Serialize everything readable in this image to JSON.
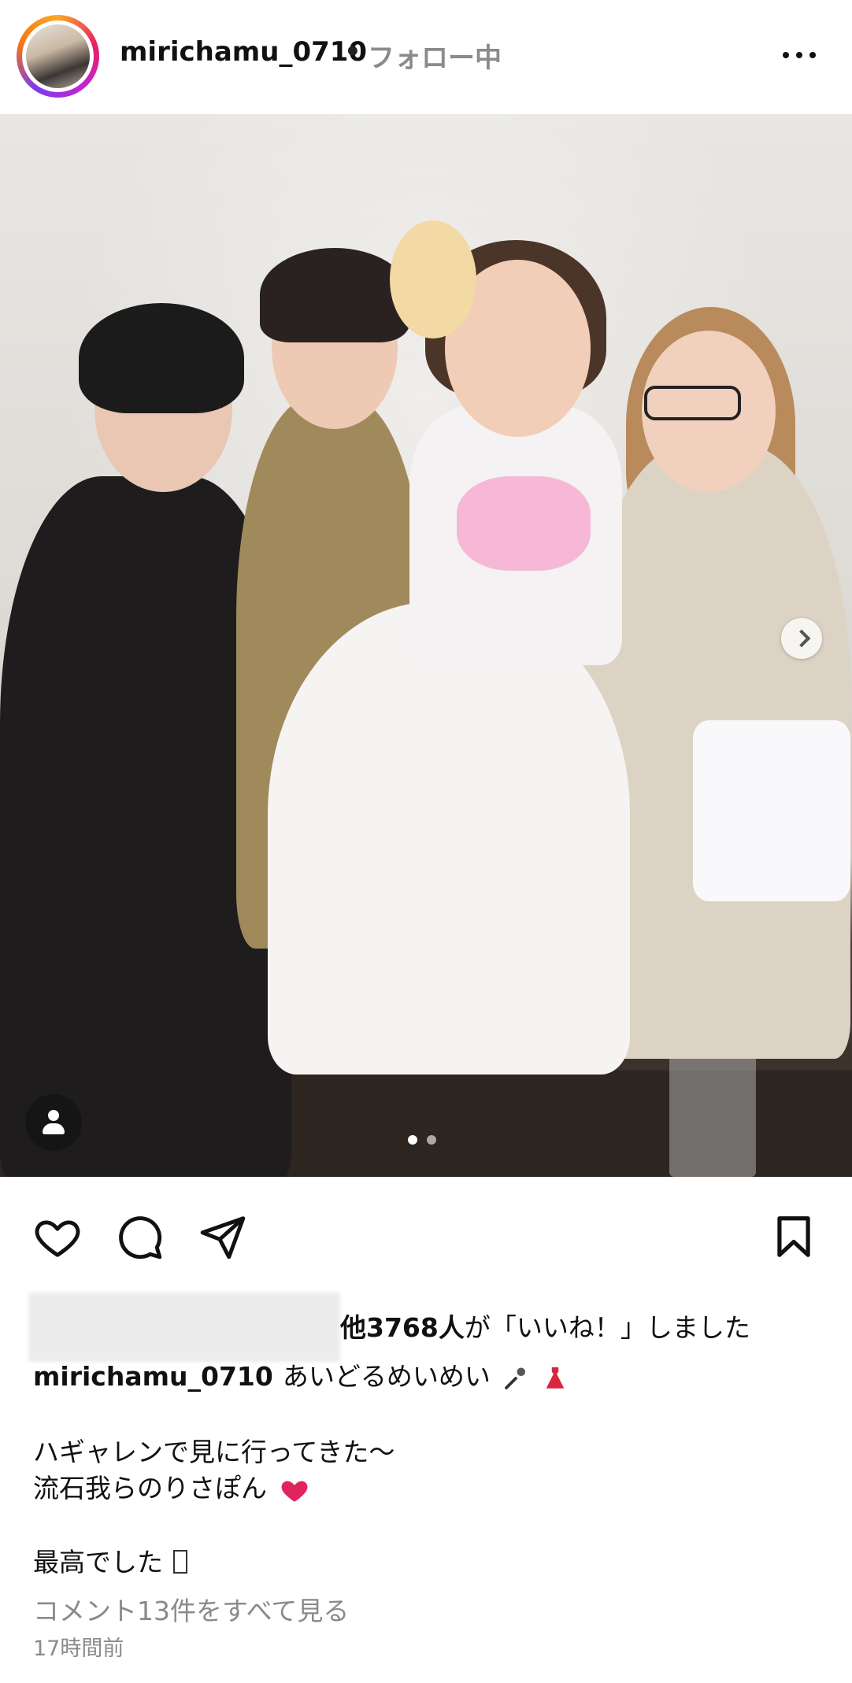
{
  "post": {
    "username": "mirichamu_0710",
    "separator": "•",
    "follow_state": "フォロー中",
    "carousel": {
      "current": 1,
      "total": 2
    }
  },
  "likes": {
    "count_text": "他3768人",
    "suffix": "が「いいね！」しました"
  },
  "caption": {
    "username": "mirichamu_0710",
    "line1": "あいどるめいめい",
    "line2": "ハギャレンで見に行ってきた〜",
    "line3": "流石我らのりさぽん",
    "line4": "最高でした"
  },
  "comments": {
    "view_all": "コメント13件をすべて見る"
  },
  "timestamp": "17時間前",
  "icons": {
    "more": "more-horizontal-icon",
    "like": "heart-icon",
    "comment": "comment-bubble-icon",
    "share": "paper-plane-icon",
    "save": "bookmark-icon",
    "tag": "person-tag-icon",
    "next": "chevron-right-icon"
  },
  "colors": {
    "text": "#111111",
    "muted": "#8a8a8a",
    "dot_active": "#ffffff",
    "dot_inactive": "#a9a9a9",
    "heart_emoji": "#e0245e",
    "dress_emoji": "#d7263d"
  }
}
